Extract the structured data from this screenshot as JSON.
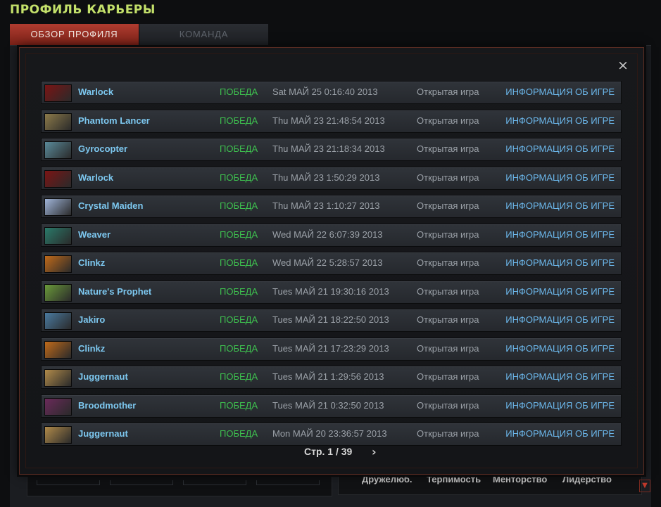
{
  "header": {
    "title": "ПРОФИЛЬ КАРЬЕРЫ"
  },
  "tabs": [
    {
      "label": "ОБЗОР ПРОФИЛЯ"
    },
    {
      "label": "КОМАНДА"
    }
  ],
  "background_stats": {
    "friendly": "Дружелюб.",
    "tolerance": "Терпимость",
    "mentoring": "Менторство",
    "leadership": "Лидерство"
  },
  "modal": {
    "close_symbol": "×",
    "matches": [
      {
        "hero": "Warlock",
        "result": "ПОБЕДА",
        "date": "Sat МАЙ 25 0:16:40 2013",
        "mode": "Открытая игра",
        "link": "ИНФОРМАЦИЯ ОБ ИГРЕ",
        "color": "#7a1414"
      },
      {
        "hero": "Phantom Lancer",
        "result": "ПОБЕДА",
        "date": "Thu МАЙ 23 21:48:54 2013",
        "mode": "Открытая игра",
        "link": "ИНФОРМАЦИЯ ОБ ИГРЕ",
        "color": "#8c7a4a"
      },
      {
        "hero": "Gyrocopter",
        "result": "ПОБЕДА",
        "date": "Thu МАЙ 23 21:18:34 2013",
        "mode": "Открытая игра",
        "link": "ИНФОРМАЦИЯ ОБ ИГРЕ",
        "color": "#5a8a9a"
      },
      {
        "hero": "Warlock",
        "result": "ПОБЕДА",
        "date": "Thu МАЙ 23 1:50:29 2013",
        "mode": "Открытая игра",
        "link": "ИНФОРМАЦИЯ ОБ ИГРЕ",
        "color": "#7a1414"
      },
      {
        "hero": "Crystal Maiden",
        "result": "ПОБЕДА",
        "date": "Thu МАЙ 23 1:10:27 2013",
        "mode": "Открытая игра",
        "link": "ИНФОРМАЦИЯ ОБ ИГРЕ",
        "color": "#9fb4d8"
      },
      {
        "hero": "Weaver",
        "result": "ПОБЕДА",
        "date": "Wed МАЙ 22 6:07:39 2013",
        "mode": "Открытая игра",
        "link": "ИНФОРМАЦИЯ ОБ ИГРЕ",
        "color": "#2a7a6a"
      },
      {
        "hero": "Clinkz",
        "result": "ПОБЕДА",
        "date": "Wed МАЙ 22 5:28:57 2013",
        "mode": "Открытая игра",
        "link": "ИНФОРМАЦИЯ ОБ ИГРЕ",
        "color": "#c06a1a"
      },
      {
        "hero": "Nature's Prophet",
        "result": "ПОБЕДА",
        "date": "Tues МАЙ 21 19:30:16 2013",
        "mode": "Открытая игра",
        "link": "ИНФОРМАЦИЯ ОБ ИГРЕ",
        "color": "#6a9a3a"
      },
      {
        "hero": "Jakiro",
        "result": "ПОБЕДА",
        "date": "Tues МАЙ 21 18:22:50 2013",
        "mode": "Открытая игра",
        "link": "ИНФОРМАЦИЯ ОБ ИГРЕ",
        "color": "#4a7aa0"
      },
      {
        "hero": "Clinkz",
        "result": "ПОБЕДА",
        "date": "Tues МАЙ 21 17:23:29 2013",
        "mode": "Открытая игра",
        "link": "ИНФОРМАЦИЯ ОБ ИГРЕ",
        "color": "#c06a1a"
      },
      {
        "hero": "Juggernaut",
        "result": "ПОБЕДА",
        "date": "Tues МАЙ 21 1:29:56 2013",
        "mode": "Открытая игра",
        "link": "ИНФОРМАЦИЯ ОБ ИГРЕ",
        "color": "#b08a4a"
      },
      {
        "hero": "Broodmother",
        "result": "ПОБЕДА",
        "date": "Tues МАЙ 21 0:32:50 2013",
        "mode": "Открытая игра",
        "link": "ИНФОРМАЦИЯ ОБ ИГРЕ",
        "color": "#6a2a5a"
      },
      {
        "hero": "Juggernaut",
        "result": "ПОБЕДА",
        "date": "Mon МАЙ 20 23:36:57 2013",
        "mode": "Открытая игра",
        "link": "ИНФОРМАЦИЯ ОБ ИГРЕ",
        "color": "#b08a4a"
      }
    ],
    "pagination": {
      "label": "Стр. 1 / 39",
      "next_symbol": "›"
    }
  },
  "colors": {
    "accent": "#c3e06a",
    "win": "#3ec24f",
    "hero": "#7dc8f0",
    "link": "#6cb8ec"
  }
}
